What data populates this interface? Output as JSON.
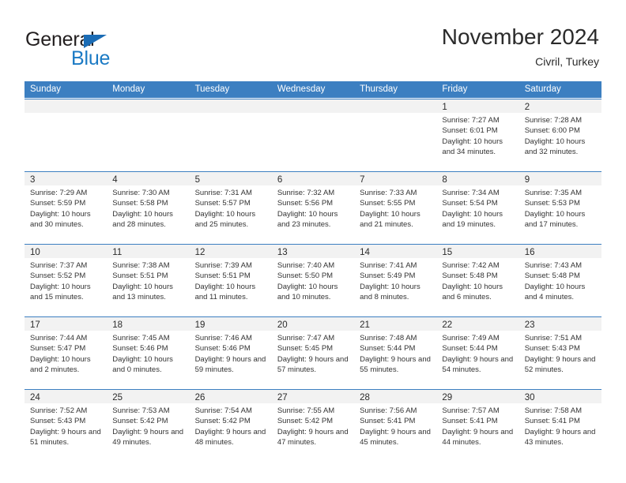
{
  "brand": {
    "name_part1": "General",
    "name_part2": "Blue",
    "triangle_icon": "brand-triangle-icon",
    "colors": {
      "black": "#231f20",
      "blue": "#1b7ac4",
      "header_blue": "#3c7fc1"
    }
  },
  "header": {
    "title": "November 2024",
    "subtitle": "Civril, Turkey"
  },
  "weekdays": [
    "Sunday",
    "Monday",
    "Tuesday",
    "Wednesday",
    "Thursday",
    "Friday",
    "Saturday"
  ],
  "weeks": [
    [
      {
        "empty": true
      },
      {
        "empty": true
      },
      {
        "empty": true
      },
      {
        "empty": true
      },
      {
        "empty": true
      },
      {
        "day": "1",
        "sunrise": "Sunrise: 7:27 AM",
        "sunset": "Sunset: 6:01 PM",
        "daylight": "Daylight: 10 hours and 34 minutes."
      },
      {
        "day": "2",
        "sunrise": "Sunrise: 7:28 AM",
        "sunset": "Sunset: 6:00 PM",
        "daylight": "Daylight: 10 hours and 32 minutes."
      }
    ],
    [
      {
        "day": "3",
        "sunrise": "Sunrise: 7:29 AM",
        "sunset": "Sunset: 5:59 PM",
        "daylight": "Daylight: 10 hours and 30 minutes."
      },
      {
        "day": "4",
        "sunrise": "Sunrise: 7:30 AM",
        "sunset": "Sunset: 5:58 PM",
        "daylight": "Daylight: 10 hours and 28 minutes."
      },
      {
        "day": "5",
        "sunrise": "Sunrise: 7:31 AM",
        "sunset": "Sunset: 5:57 PM",
        "daylight": "Daylight: 10 hours and 25 minutes."
      },
      {
        "day": "6",
        "sunrise": "Sunrise: 7:32 AM",
        "sunset": "Sunset: 5:56 PM",
        "daylight": "Daylight: 10 hours and 23 minutes."
      },
      {
        "day": "7",
        "sunrise": "Sunrise: 7:33 AM",
        "sunset": "Sunset: 5:55 PM",
        "daylight": "Daylight: 10 hours and 21 minutes."
      },
      {
        "day": "8",
        "sunrise": "Sunrise: 7:34 AM",
        "sunset": "Sunset: 5:54 PM",
        "daylight": "Daylight: 10 hours and 19 minutes."
      },
      {
        "day": "9",
        "sunrise": "Sunrise: 7:35 AM",
        "sunset": "Sunset: 5:53 PM",
        "daylight": "Daylight: 10 hours and 17 minutes."
      }
    ],
    [
      {
        "day": "10",
        "sunrise": "Sunrise: 7:37 AM",
        "sunset": "Sunset: 5:52 PM",
        "daylight": "Daylight: 10 hours and 15 minutes."
      },
      {
        "day": "11",
        "sunrise": "Sunrise: 7:38 AM",
        "sunset": "Sunset: 5:51 PM",
        "daylight": "Daylight: 10 hours and 13 minutes."
      },
      {
        "day": "12",
        "sunrise": "Sunrise: 7:39 AM",
        "sunset": "Sunset: 5:51 PM",
        "daylight": "Daylight: 10 hours and 11 minutes."
      },
      {
        "day": "13",
        "sunrise": "Sunrise: 7:40 AM",
        "sunset": "Sunset: 5:50 PM",
        "daylight": "Daylight: 10 hours and 10 minutes."
      },
      {
        "day": "14",
        "sunrise": "Sunrise: 7:41 AM",
        "sunset": "Sunset: 5:49 PM",
        "daylight": "Daylight: 10 hours and 8 minutes."
      },
      {
        "day": "15",
        "sunrise": "Sunrise: 7:42 AM",
        "sunset": "Sunset: 5:48 PM",
        "daylight": "Daylight: 10 hours and 6 minutes."
      },
      {
        "day": "16",
        "sunrise": "Sunrise: 7:43 AM",
        "sunset": "Sunset: 5:48 PM",
        "daylight": "Daylight: 10 hours and 4 minutes."
      }
    ],
    [
      {
        "day": "17",
        "sunrise": "Sunrise: 7:44 AM",
        "sunset": "Sunset: 5:47 PM",
        "daylight": "Daylight: 10 hours and 2 minutes."
      },
      {
        "day": "18",
        "sunrise": "Sunrise: 7:45 AM",
        "sunset": "Sunset: 5:46 PM",
        "daylight": "Daylight: 10 hours and 0 minutes."
      },
      {
        "day": "19",
        "sunrise": "Sunrise: 7:46 AM",
        "sunset": "Sunset: 5:46 PM",
        "daylight": "Daylight: 9 hours and 59 minutes."
      },
      {
        "day": "20",
        "sunrise": "Sunrise: 7:47 AM",
        "sunset": "Sunset: 5:45 PM",
        "daylight": "Daylight: 9 hours and 57 minutes."
      },
      {
        "day": "21",
        "sunrise": "Sunrise: 7:48 AM",
        "sunset": "Sunset: 5:44 PM",
        "daylight": "Daylight: 9 hours and 55 minutes."
      },
      {
        "day": "22",
        "sunrise": "Sunrise: 7:49 AM",
        "sunset": "Sunset: 5:44 PM",
        "daylight": "Daylight: 9 hours and 54 minutes."
      },
      {
        "day": "23",
        "sunrise": "Sunrise: 7:51 AM",
        "sunset": "Sunset: 5:43 PM",
        "daylight": "Daylight: 9 hours and 52 minutes."
      }
    ],
    [
      {
        "day": "24",
        "sunrise": "Sunrise: 7:52 AM",
        "sunset": "Sunset: 5:43 PM",
        "daylight": "Daylight: 9 hours and 51 minutes."
      },
      {
        "day": "25",
        "sunrise": "Sunrise: 7:53 AM",
        "sunset": "Sunset: 5:42 PM",
        "daylight": "Daylight: 9 hours and 49 minutes."
      },
      {
        "day": "26",
        "sunrise": "Sunrise: 7:54 AM",
        "sunset": "Sunset: 5:42 PM",
        "daylight": "Daylight: 9 hours and 48 minutes."
      },
      {
        "day": "27",
        "sunrise": "Sunrise: 7:55 AM",
        "sunset": "Sunset: 5:42 PM",
        "daylight": "Daylight: 9 hours and 47 minutes."
      },
      {
        "day": "28",
        "sunrise": "Sunrise: 7:56 AM",
        "sunset": "Sunset: 5:41 PM",
        "daylight": "Daylight: 9 hours and 45 minutes."
      },
      {
        "day": "29",
        "sunrise": "Sunrise: 7:57 AM",
        "sunset": "Sunset: 5:41 PM",
        "daylight": "Daylight: 9 hours and 44 minutes."
      },
      {
        "day": "30",
        "sunrise": "Sunrise: 7:58 AM",
        "sunset": "Sunset: 5:41 PM",
        "daylight": "Daylight: 9 hours and 43 minutes."
      }
    ]
  ]
}
